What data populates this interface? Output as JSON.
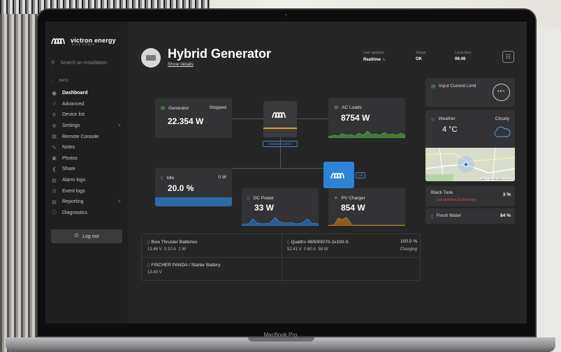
{
  "device": {
    "label": "MacBook Pro"
  },
  "sidebar": {
    "brand": "victron energy",
    "tagline": "BLUE POWER",
    "search_placeholder": "Search an installation",
    "back_label": "BACK",
    "items": [
      {
        "label": "Dashboard",
        "icon": "dashboard-icon",
        "active": true
      },
      {
        "label": "Advanced",
        "icon": "chart-line-icon"
      },
      {
        "label": "Device list",
        "icon": "location-pin-icon"
      },
      {
        "label": "Settings",
        "icon": "gear-icon",
        "expand": "+"
      },
      {
        "label": "Remote Console",
        "icon": "console-icon"
      },
      {
        "label": "Notes",
        "icon": "notes-icon"
      },
      {
        "label": "Photos",
        "icon": "photos-icon"
      },
      {
        "label": "Share",
        "icon": "share-icon"
      },
      {
        "label": "Alarm logs",
        "icon": "alarm-icon"
      },
      {
        "label": "Event logs",
        "icon": "clock-icon"
      },
      {
        "label": "Reporting",
        "icon": "report-icon",
        "expand": "+"
      },
      {
        "label": "Diagnostics",
        "icon": "info-icon"
      }
    ],
    "logout_label": "Log out"
  },
  "header": {
    "title": "Hybrid Generator",
    "details_link": "Show details",
    "last_updated_label": "Last updated:",
    "last_updated_value": "Realtime",
    "status_label": "Status:",
    "status_value": "OK",
    "local_time_label": "Local time:",
    "local_time_value": "06:46"
  },
  "cards": {
    "generator": {
      "label": "Generator",
      "state": "Stopped",
      "value": "22.354 W"
    },
    "ac_loads": {
      "label": "AC Loads",
      "value": "8754 W"
    },
    "idle": {
      "label": "Idle",
      "power": "0 W",
      "value": "20.0 %"
    },
    "dc_power": {
      "label": "DC Power",
      "value": "33 W"
    },
    "pv_charger": {
      "label": "PV Charger",
      "value": "854 W"
    },
    "external_control": "External control",
    "inverter_state": "Off"
  },
  "batteries": [
    {
      "name": "Bow Thruster Batteries",
      "voltage": "13.46 V",
      "current": "0.10 A",
      "power": "1 W",
      "soc": "",
      "state": ""
    },
    {
      "name": "Quattro 48/5000/70-2x100-S",
      "voltage": "52.41 V",
      "current": "0.60 A",
      "power": "58 W",
      "soc": "100.0 %",
      "state": "Charging"
    },
    {
      "name": "FISCHER PANDA / Starter Battery",
      "voltage": "13.40 V",
      "current": "",
      "power": "",
      "soc": "",
      "state": ""
    }
  ],
  "right": {
    "input_limit_label": "Input Current Limit",
    "input_limit_gauge": "4.9 A",
    "weather_label": "Weather",
    "weather_state": "Cloudy",
    "temperature": "4 °C",
    "map_credit": "Leaflet | © OpenStreetMap contributors",
    "tanks": [
      {
        "name": "Black Tank",
        "level": "3 %",
        "note": "Last updated 15 days ago"
      },
      {
        "name": "Fresh Water",
        "level": "84 %",
        "note": ""
      }
    ]
  },
  "colors": {
    "accent_blue": "#2d84d6",
    "green": "#5eb84d",
    "orange": "#e59a2c",
    "alert": "#e04b4b"
  }
}
